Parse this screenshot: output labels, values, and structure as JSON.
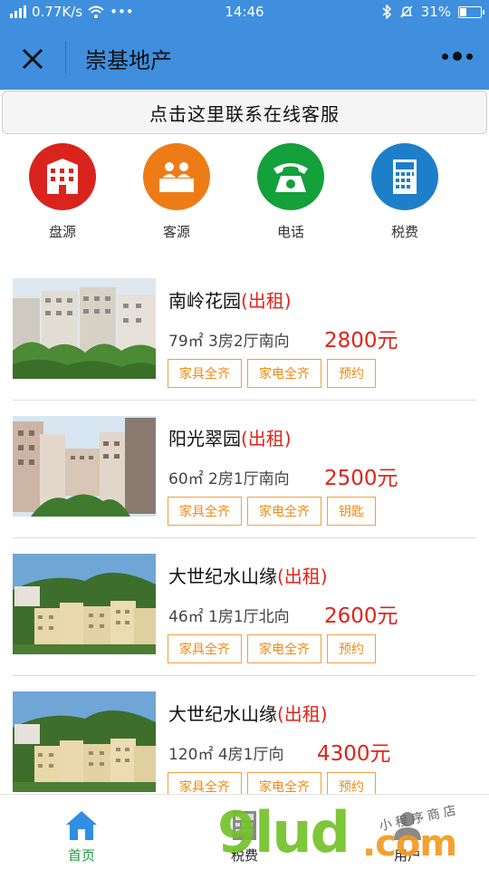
{
  "status_bar": {
    "speed": "0.77K/s",
    "dots": "•••",
    "time": "14:46",
    "battery": "31%"
  },
  "nav": {
    "title": "崇基地产"
  },
  "contact_button": "点击这里联系在线客服",
  "grid": [
    {
      "label": "盘源",
      "icon": "building-icon",
      "color": "#d9231d"
    },
    {
      "label": "客源",
      "icon": "clients-icon",
      "color": "#ee7c16"
    },
    {
      "label": "电话",
      "icon": "telephone-icon",
      "color": "#14a03a"
    },
    {
      "label": "税费",
      "icon": "calculator-icon",
      "color": "#1d7fc9"
    }
  ],
  "listings": [
    {
      "name": "南岭花园",
      "rent_tag": "(出租)",
      "meta": "79㎡ 3房2厅南向",
      "price": "2800元",
      "tags": [
        "家具全齐",
        "家电全齐",
        "预约"
      ]
    },
    {
      "name": "阳光翠园",
      "rent_tag": "(出租)",
      "meta": "60㎡ 2房1厅南向",
      "price": "2500元",
      "tags": [
        "家具全齐",
        "家电全齐",
        "钥匙"
      ]
    },
    {
      "name": "大世纪水山缘",
      "rent_tag": "(出租)",
      "meta": "46㎡ 1房1厅北向",
      "price": "2600元",
      "tags": [
        "家具全齐",
        "家电全齐",
        "预约"
      ]
    },
    {
      "name": "大世纪水山缘",
      "rent_tag": "(出租)",
      "meta": "120㎡ 4房1厅向",
      "price": "4300元",
      "tags": [
        "家具全齐",
        "家电全齐",
        "预约"
      ]
    }
  ],
  "tabbar": [
    {
      "label": "首页",
      "icon": "home-icon",
      "active": true
    },
    {
      "label": "税费",
      "icon": "calculator-icon",
      "active": false
    },
    {
      "label": "用户",
      "icon": "user-icon",
      "active": false
    }
  ],
  "watermark": {
    "main": "9lud",
    "suffix": ".com",
    "small": "小程序商店"
  },
  "colors": {
    "brand": "#3f8fde",
    "price": "#e0241b",
    "tag": "#f08a14",
    "tab_active": "#1b9c3d"
  }
}
